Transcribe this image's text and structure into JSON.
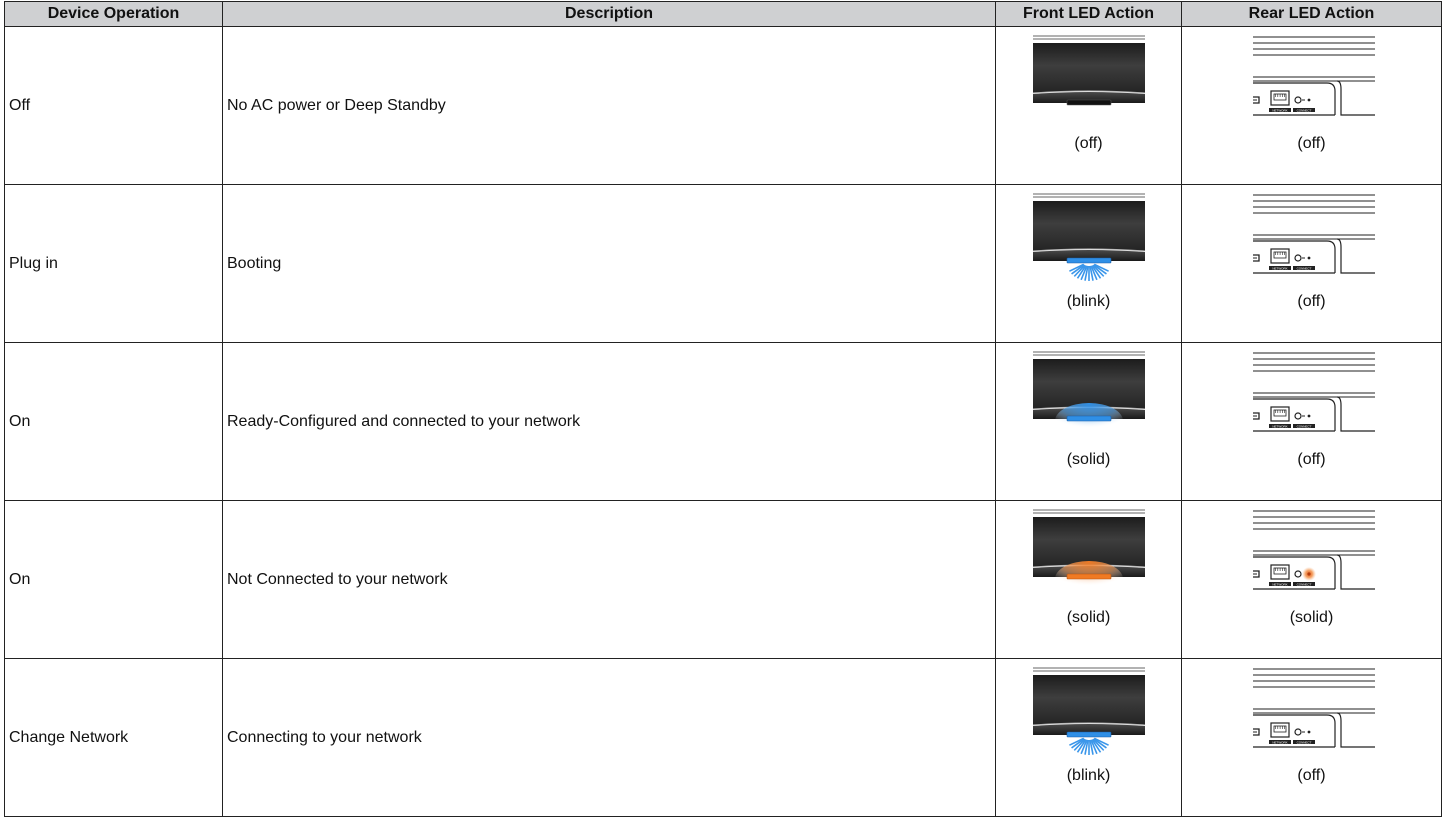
{
  "headers": {
    "operation": "Device Operation",
    "description": "Description",
    "front": "Front LED Action",
    "rear": "Rear LED Action"
  },
  "rows": [
    {
      "operation": "Off",
      "description": "No AC power or Deep Standby",
      "front": {
        "state": "off",
        "caption": "(off)"
      },
      "rear": {
        "state": "off",
        "caption": "(off)"
      }
    },
    {
      "operation": "Plug in",
      "description": "Booting",
      "front": {
        "state": "blink-blue",
        "caption": "(blink)"
      },
      "rear": {
        "state": "off",
        "caption": "(off)"
      }
    },
    {
      "operation": "On",
      "description": "Ready-Configured and connected to your network",
      "front": {
        "state": "solid-blue",
        "caption": "(solid)"
      },
      "rear": {
        "state": "off",
        "caption": "(off)"
      }
    },
    {
      "operation": "On",
      "description": "Not Connected to your network",
      "front": {
        "state": "solid-orange",
        "caption": "(solid)"
      },
      "rear": {
        "state": "solid-orange",
        "caption": "(solid)"
      }
    },
    {
      "operation": "Change Network",
      "description": "Connecting to your network",
      "front": {
        "state": "blink-blue",
        "caption": "(blink)"
      },
      "rear": {
        "state": "off",
        "caption": "(off)"
      }
    }
  ],
  "colors": {
    "header_bg": "#cfd0d2",
    "led_blue": "#2f8fe6",
    "led_orange": "#f07a23",
    "device_dark": "#2b2b2b"
  },
  "rear_labels": {
    "network": "NETWORK",
    "connect": "CONNECT"
  }
}
